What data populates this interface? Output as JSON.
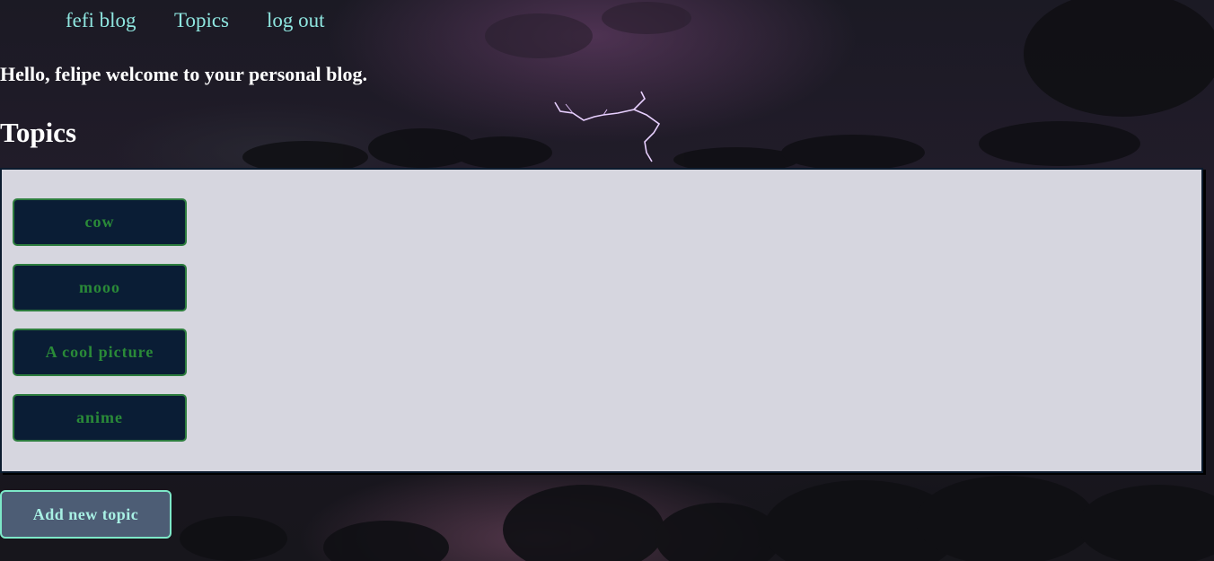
{
  "nav": {
    "brand": "fefi blog",
    "topics": "Topics",
    "logout": "log out"
  },
  "greeting": "Hello, felipe welcome to your personal blog.",
  "page_title": "Topics",
  "topics": [
    {
      "label": "cow"
    },
    {
      "label": "mooo"
    },
    {
      "label": "A cool picture"
    },
    {
      "label": "anime"
    }
  ],
  "add_topic_label": "Add new topic",
  "colors": {
    "nav_link": "#8fe6e0",
    "panel_bg": "#d6d6df",
    "topic_button_bg": "#0a1d35",
    "topic_button_text": "#2a8a38",
    "add_button_bg": "#4d5d75",
    "add_button_border": "#7de8c8"
  }
}
